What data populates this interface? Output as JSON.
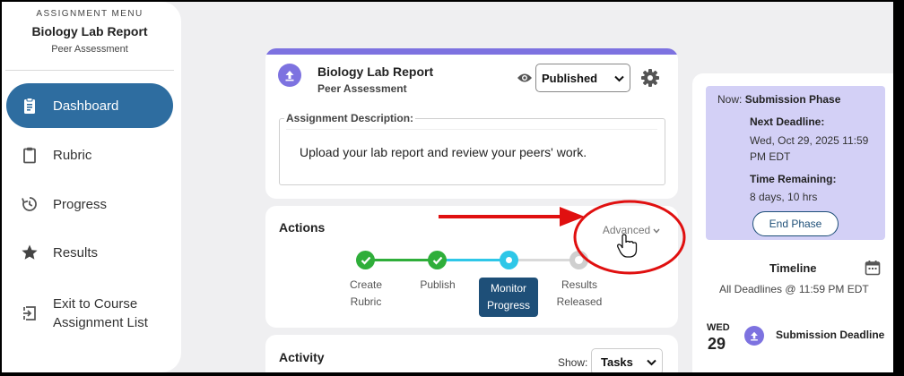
{
  "sidebar": {
    "caption": "ASSIGNMENT MENU",
    "title": "Biology Lab Report",
    "subtitle": "Peer Assessment",
    "items": [
      {
        "label": "Dashboard",
        "icon": "clipboard-icon",
        "active": true
      },
      {
        "label": "Rubric",
        "icon": "clipboard-outline-icon"
      },
      {
        "label": "Progress",
        "icon": "history-icon"
      },
      {
        "label": "Results",
        "icon": "star-icon"
      },
      {
        "label": "Exit to Course\nAssignment List",
        "icon": "exit-icon"
      }
    ]
  },
  "header": {
    "title": "Biology Lab Report",
    "subtitle": "Peer Assessment",
    "status_value": "Published",
    "description_legend": "Assignment Description:",
    "description_text": "Upload your lab report and review your peers' work."
  },
  "actions": {
    "title": "Actions",
    "advanced_label": "Advanced",
    "steps": [
      {
        "label": "Create\nRubric",
        "state": "done"
      },
      {
        "label": "Publish",
        "state": "done"
      },
      {
        "label": "Monitor\nProgress",
        "state": "current"
      },
      {
        "label": "Results\nReleased",
        "state": "pending"
      }
    ]
  },
  "activity": {
    "title": "Activity",
    "show_label": "Show:",
    "show_value": "Tasks"
  },
  "phase": {
    "now_prefix": "Now:",
    "now_phase": "Submission Phase",
    "deadline_label": "Next Deadline:",
    "deadline_value": "Wed, Oct 29, 2025 11:59 PM EDT",
    "remaining_label": "Time Remaining:",
    "remaining_value": "8 days, 10 hrs",
    "end_button": "End Phase"
  },
  "timeline": {
    "title": "Timeline",
    "subtitle": "All Deadlines @ 11:59 PM EDT",
    "day": "WED",
    "date": "29",
    "event": "Submission Deadline"
  },
  "colors": {
    "accent": "#7d72e0",
    "primary": "#2e6da0",
    "done": "#2fae3a",
    "current": "#2ec7e8",
    "pending": "#cfcfcf",
    "annotation": "#e01010"
  }
}
